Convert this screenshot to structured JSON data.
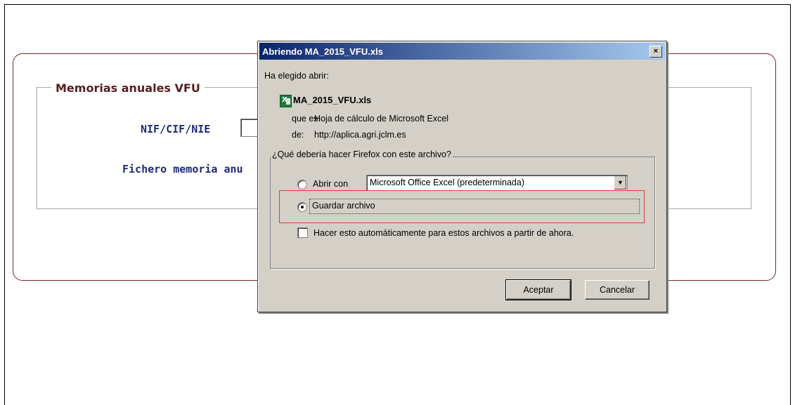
{
  "background_form": {
    "legend": "Memorias anuales VFU",
    "nif_label": "NIF/CIF/NIE",
    "fichero_label": "Fichero memoria anu"
  },
  "dialog": {
    "title": "Abriendo MA_2015_VFU.xls",
    "close_glyph": "×",
    "chosen_text": "Ha elegido abrir:",
    "file_name": "MA_2015_VFU.xls",
    "type_label": "que es:",
    "type_value": "Hoja de cálculo de Microsoft Excel",
    "source_label": "de:",
    "source_value": "http://aplica.agri.jclm.es",
    "group_legend": "¿Qué debería hacer Firefox con este archivo?",
    "open_with_label": "Abrir con",
    "open_with_value": "Microsoft Office Excel (predeterminada)",
    "save_label": "Guardar archivo",
    "auto_label": "Hacer esto automáticamente para estos archivos a partir de ahora.",
    "ok_label": "Aceptar",
    "cancel_label": "Cancelar",
    "selected_option": "save",
    "highlight_color": "#e03a3a"
  },
  "colors": {
    "titlebar_start": "#0a246a",
    "titlebar_end": "#a6caf0",
    "panel_border": "#7a2a2a",
    "label_blue": "#1f2a78"
  }
}
